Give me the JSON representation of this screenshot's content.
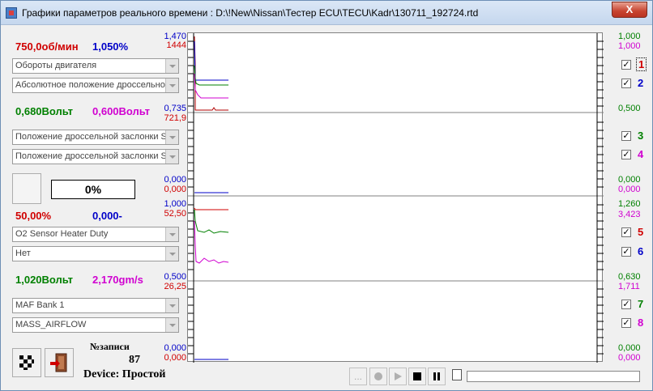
{
  "window": {
    "title": "Графики параметров реального времени : D:\\!New\\Nissan\\Тестер ECU\\TECU\\Kadr\\130711_192724.rtd",
    "close_label": "X"
  },
  "left": {
    "group1": {
      "val_a": "750,0об/мин",
      "val_b": "1,050%",
      "combo_a": "Обороты двигателя",
      "combo_b": "Абсолютное положение дроссельно"
    },
    "group2": {
      "val_a": "0,680Вольт",
      "val_b": "0,600Вольт",
      "combo_a": "Положение дроссельной заслонки S",
      "combo_b": "Положение дроссельной заслонки S"
    },
    "percent_display": "0%",
    "group3": {
      "val_a": "50,00%",
      "val_b": "0,000-",
      "combo_a": "O2 Sensor Heater Duty",
      "combo_b": "Нет"
    },
    "group4": {
      "val_a": "1,020Вольт",
      "val_b": "2,170gm/s",
      "combo_a": "MAF Bank 1",
      "combo_b": "MASS_AIRFLOW"
    },
    "record_label": "№записи",
    "record_number": "87",
    "device_text": "Device: Простой"
  },
  "graph": {
    "p1": {
      "ly1": "1,470",
      "ly2": "1444",
      "lb1": "0,735",
      "lb2": "721,9",
      "ry1": "1,000",
      "ry2": "1,000",
      "rb": "0,500"
    },
    "p2": {
      "lb1": "0,000",
      "lb2": "0,000",
      "rb1": "0,000",
      "rb2": "0,000"
    },
    "p3": {
      "ly1": "1,000",
      "ly2": "52,50",
      "lb1": "0,500",
      "lb2": "26,25",
      "ry1": "1,260",
      "ry2": "3,423",
      "rb": "0,630",
      "rb2": "1,711"
    },
    "p4": {
      "lb1": "0,000",
      "lb2": "0,000",
      "rb1": "0,000",
      "rb2": "0,000"
    }
  },
  "checks": [
    "1",
    "2",
    "3",
    "4",
    "5",
    "6",
    "7",
    "8"
  ],
  "colors": {
    "red": "#d00000",
    "blue": "#0000c8",
    "green": "#008000",
    "magenta": "#d000d0"
  },
  "playback": {
    "dots": "..."
  }
}
